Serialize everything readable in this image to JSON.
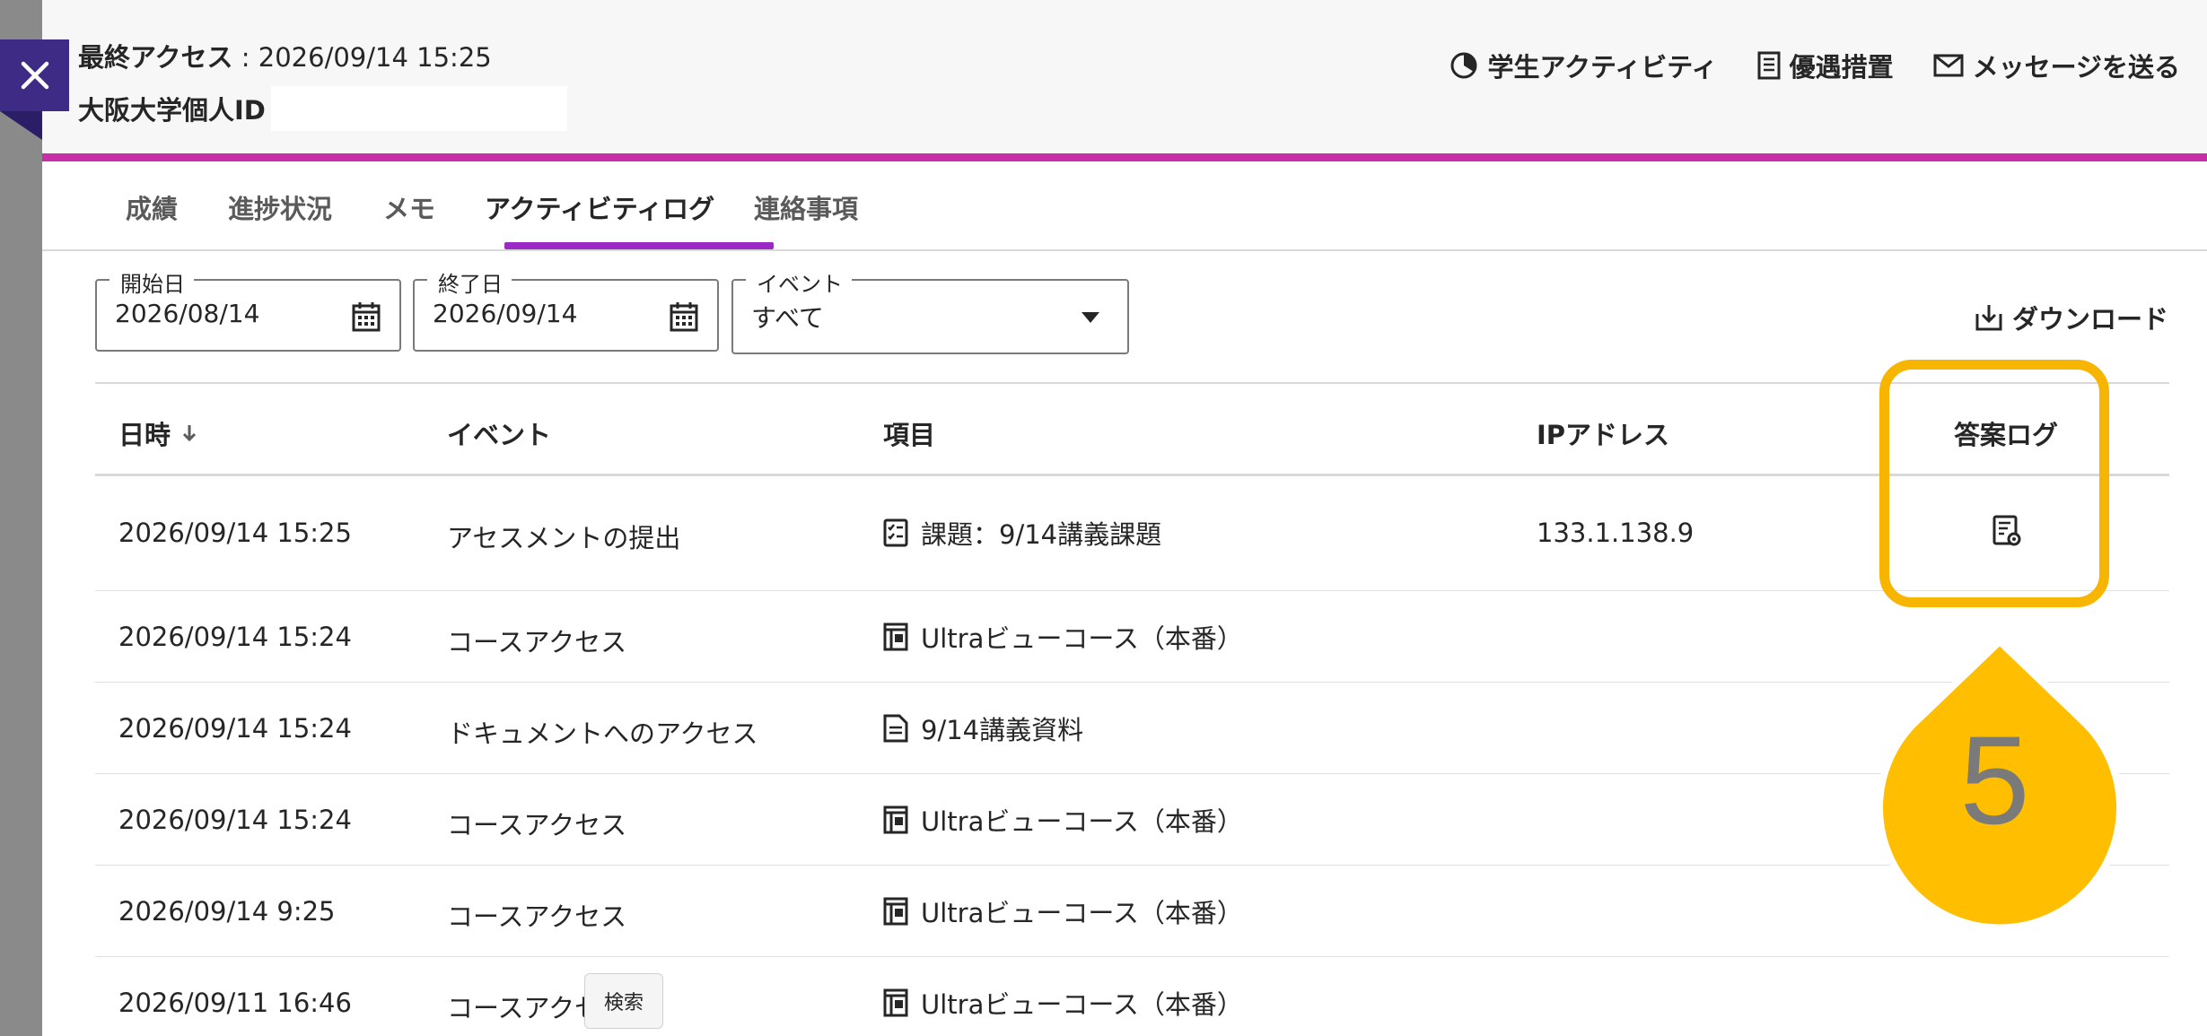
{
  "header": {
    "last_access_label": "最終アクセス",
    "last_access_sep": ":",
    "last_access_value": "2026/09/14 15:25",
    "uid_label": "大阪大学個人ID",
    "actions": [
      {
        "label": "学生アクティビティ",
        "icon": "activity-clock-icon"
      },
      {
        "label": "優遇措置",
        "icon": "document-list-icon"
      },
      {
        "label": "メッセージを送る",
        "icon": "envelope-icon"
      }
    ]
  },
  "tabs": [
    "成績",
    "進捗状況",
    "メモ",
    "アクティビティログ",
    "連絡事項"
  ],
  "active_tab": "アクティビティログ",
  "filters": {
    "start": {
      "legend": "開始日",
      "value": "2026/08/14",
      "icon": "calendar-icon"
    },
    "end": {
      "legend": "終了日",
      "value": "2026/09/14",
      "icon": "calendar-icon"
    },
    "event": {
      "legend": "イベント",
      "value": "すべて",
      "icon": "dropdown-arrow-icon"
    }
  },
  "download_label": "ダウンロード",
  "table": {
    "headers": {
      "date": "日時",
      "event": "イベント",
      "item": "項目",
      "ip": "IPアドレス",
      "answer_log": "答案ログ"
    },
    "sort_icon": "arrow-down-icon",
    "rows": [
      {
        "date": "2026/09/14 15:25",
        "event": "アセスメントの提出",
        "item": "課題：9/14講義課題",
        "item_icon": "assignment-icon",
        "ip": "133.1.138.9",
        "answer_log_icon": "answer-log-icon"
      },
      {
        "date": "2026/09/14 15:24",
        "event": "コースアクセス",
        "item": "Ultraビューコース（本番）",
        "item_icon": "course-icon",
        "ip": "",
        "answer_log_icon": ""
      },
      {
        "date": "2026/09/14 15:24",
        "event": "ドキュメントへのアクセス",
        "item": "9/14講義資料",
        "item_icon": "document-icon",
        "ip": "",
        "answer_log_icon": ""
      },
      {
        "date": "2026/09/14 15:24",
        "event": "コースアクセス",
        "item": "Ultraビューコース（本番）",
        "item_icon": "course-icon",
        "ip": "",
        "answer_log_icon": ""
      },
      {
        "date": "2026/09/14 9:25",
        "event": "コースアクセス",
        "item": "Ultraビューコース（本番）",
        "item_icon": "course-icon",
        "ip": "",
        "answer_log_icon": ""
      },
      {
        "date": "2026/09/11 16:46",
        "event": "コースアクセ",
        "item": "Ultraビューコース（本番）",
        "item_icon": "course-icon",
        "ip": "",
        "answer_log_icon": ""
      }
    ]
  },
  "callout_number": "5",
  "tooltip": "検索",
  "colors": {
    "accent_bar": "#c82ea8",
    "tab_underline": "#9b2ac4",
    "close_button": "#3d2b86",
    "highlight": "#f7b500"
  }
}
